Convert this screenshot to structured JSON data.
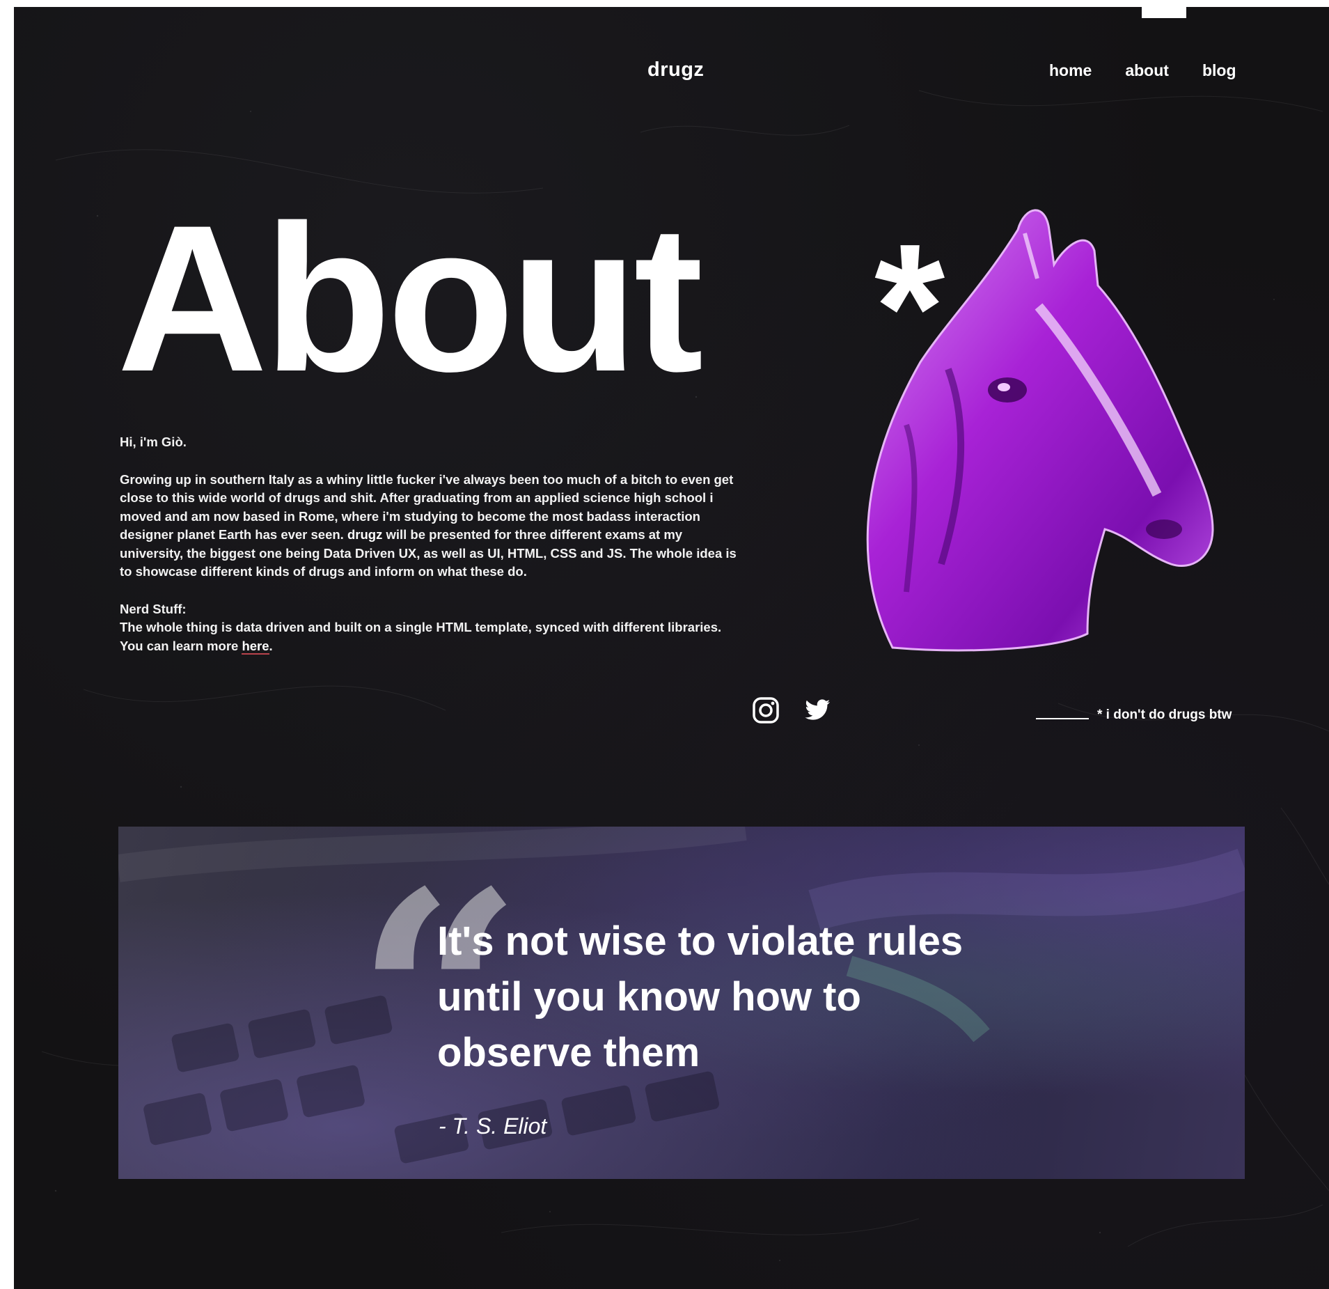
{
  "header": {
    "brand": "drugz",
    "nav": [
      "home",
      "about",
      "blog"
    ]
  },
  "hero": {
    "title": "About",
    "asterisk": "*",
    "image": "purple-chrome-horse-head"
  },
  "bio": {
    "greeting": "Hi, i'm Giò.",
    "paragraph_a": "Growing up in southern Italy as a whiny little fucker i've always been too much of a bitch to even get close to this wide world of drugs and shit. After graduating from an applied science high school i moved and am now based in Rome, where i'm studying to become the most badass interaction designer planet Earth has ever seen. ",
    "paragraph_bold": "drugz",
    "paragraph_b": " will be presented for three different exams at my university, the biggest one being Data Driven UX, as well as UI, HTML, CSS  and JS.  The whole idea is to showcase different kinds of drugs and inform on what these do.",
    "nerd_heading": "Nerd Stuff:",
    "nerd_text": "The whole thing is data driven and built on a single HTML template, synced with different libraries. You can learn more ",
    "nerd_link": "here",
    "nerd_end": "."
  },
  "social": {
    "icons": [
      "instagram-icon",
      "twitter-icon"
    ]
  },
  "disclaimer": "* i don't do drugs btw",
  "quote": {
    "mark": "“",
    "text": "It's not wise to violate rules until you know how to observe them",
    "author": "- T. S. Eliot"
  },
  "colors": {
    "background": "#131214",
    "text": "#ffffff",
    "accent": "#b026d8"
  }
}
